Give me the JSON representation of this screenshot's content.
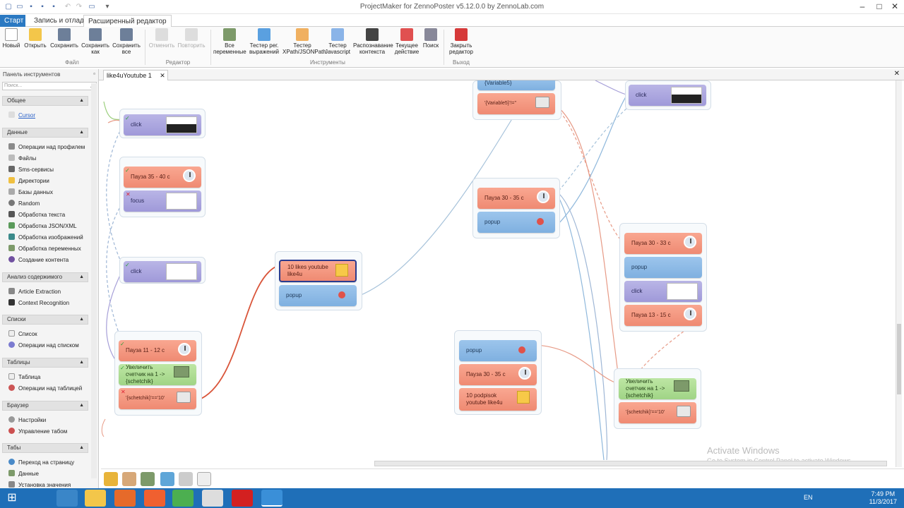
{
  "window": {
    "title": "ProjectMaker for ZennoPoster v5.12.0.0 by ZennoLab.com"
  },
  "ribbon_tabs": [
    "Старт",
    "Запись и отладка",
    "Расширенный редактор"
  ],
  "ribbon": {
    "file": {
      "label": "Файл",
      "new": "Новый",
      "open": "Открыть",
      "save": "Сохранить",
      "save_as": "Сохранить как",
      "save_all": "Сохранить все"
    },
    "editor": {
      "label": "Редактор",
      "undo": "Отменить",
      "redo": "Повторить"
    },
    "tools": {
      "label": "Инструменты",
      "all_vars": "Все переменные",
      "regex": "Тестер рег. выражений",
      "xpath": "Тестер XPath/JSONPath",
      "js": "Тестер Javascript",
      "context": "Распознавание контекста",
      "current": "Текущее действие",
      "search": "Поиск"
    },
    "exit": {
      "label": "Выход",
      "close": "Закрыть редактор"
    }
  },
  "panel": {
    "title": "Панель инструментов",
    "search_placeholder": "Поиск...",
    "sections": [
      {
        "label": "Общее",
        "items": [
          "Cursor"
        ]
      },
      {
        "label": "Данные",
        "items": [
          "Операции над профилем",
          "Файлы",
          "Sms-сервисы",
          "Директории",
          "Базы данных",
          "Random",
          "Обработка текста",
          "Обработка JSON/XML",
          "Обработка изображений",
          "Обработка переменных",
          "Создание контента"
        ]
      },
      {
        "label": "Анализ содержимого",
        "items": [
          "Article Extraction",
          "Context Recognition"
        ]
      },
      {
        "label": "Списки",
        "items": [
          "Список",
          "Операции над списком"
        ]
      },
      {
        "label": "Таблицы",
        "items": [
          "Таблица",
          "Операции над таблицей"
        ]
      },
      {
        "label": "Браузер",
        "items": [
          "Настройки",
          "Управление табом"
        ]
      },
      {
        "label": "Табы",
        "items": [
          "Переход на страницу",
          "Данные",
          "Установка значения"
        ]
      }
    ]
  },
  "doc_tab": "like4uYoutube 1",
  "nodes": {
    "click1": "click",
    "pause1": "Пауза 35 - 40 с",
    "focus": "focus",
    "click2": "click",
    "pause2": "Пауза 11 - 12 с",
    "counter1": "Увеличить счетчик на 1 -> {schetchik}",
    "cond1": "'{schetchik}'=='10'",
    "note1": "10 likes youtube like4u",
    "popup1": "popup",
    "var5": "{Variable5}",
    "var5cond": "'{Variable5}'!=''",
    "pause3": "Пауза 30 - 35 с",
    "popup2": "popup",
    "popup3": "popup",
    "pause4": "Пауза 30 - 35 с",
    "note2": "10 podpisok youtube like4u",
    "click3": "click",
    "pause5": "Пауза 30 - 33 с",
    "popup4": "popup",
    "click4": "click",
    "pause6": "Пауза 13 - 15 с",
    "counter2": "Увеличить счетчик на 1 -> {schetchik}",
    "cond2": "'{schetchik}'=='10'"
  },
  "watermark": {
    "line1": "Activate Windows",
    "line2": "Go to System in Control Panel to activate Windows."
  },
  "taskbar": {
    "lang": "EN",
    "time": "7:49 PM",
    "date": "11/3/2017"
  }
}
